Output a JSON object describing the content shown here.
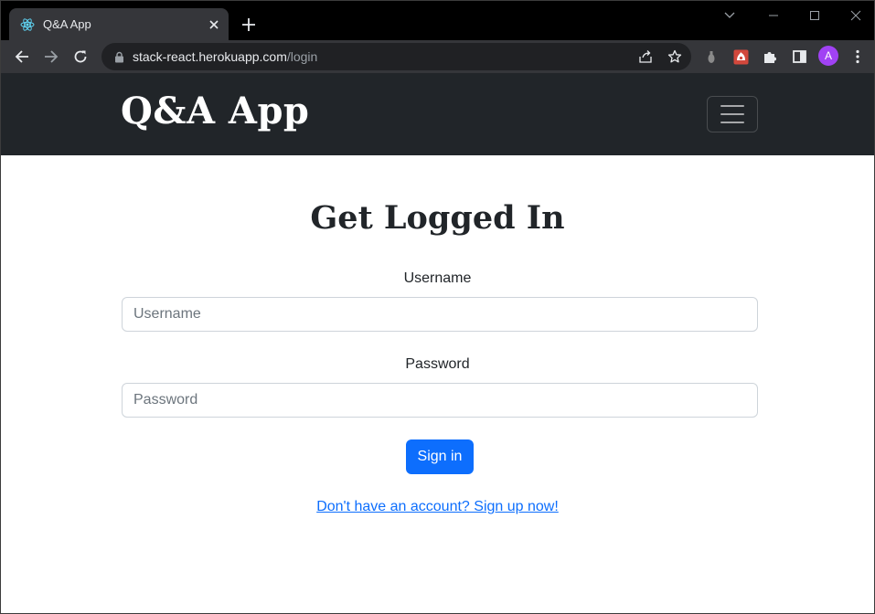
{
  "browser": {
    "tab_title": "Q&A App",
    "url_host": "stack-react.herokuapp.com",
    "url_path": "/login",
    "avatar_initial": "A",
    "icons": {
      "favicon": "react-logo-icon",
      "tab_close": "close-icon",
      "new_tab": "plus-icon",
      "back": "back-arrow-icon",
      "forward": "forward-arrow-icon",
      "reload": "reload-icon",
      "lock": "lock-icon",
      "share": "share-icon",
      "bookmark": "star-icon",
      "extensions": "puzzle-icon",
      "side_panel": "side-panel-icon",
      "menu": "kebab-menu-icon"
    },
    "colors": {
      "frame": "#000000",
      "toolbar": "#35363a",
      "omnibox": "#202124",
      "avatar": "#a142f4"
    }
  },
  "navbar": {
    "brand": "Q&A App",
    "toggler_icon": "hamburger-menu-icon",
    "background": "#212529"
  },
  "login": {
    "heading": "Get Logged In",
    "username_label": "Username",
    "username_placeholder": "Username",
    "username_value": "",
    "password_label": "Password",
    "password_placeholder": "Password",
    "password_value": "",
    "signin_label": "Sign in",
    "signup_link": "Don't have an account? Sign up now!",
    "accent": "#0d6efd"
  }
}
